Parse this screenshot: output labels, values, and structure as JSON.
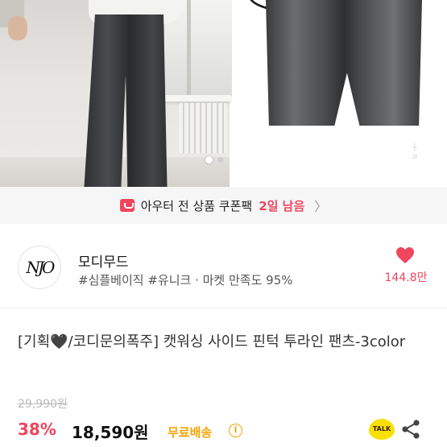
{
  "gallery": {
    "dots": 2,
    "active_dot": 1,
    "watermark": "|-/\n/-/̲"
  },
  "coupon_banner": {
    "text": "아우터 전 상품 쿠폰팩",
    "highlight": "2일 남음",
    "arrow": "〉",
    "accent_color": "#f0455d"
  },
  "shop": {
    "logo_text": "NJO",
    "name": "모디무드",
    "tags": "#심플베이직 #유니크 · 마켓 만족도 95%",
    "likes": "144.8만",
    "heart_color": "#f0455d"
  },
  "product": {
    "title": "[기획🖤/코디문의폭주] 캣워싱 사이드 핀턱 투라인 팬츠-3color",
    "original_price": "29,990원",
    "discount": "38%",
    "price": "18,590원",
    "shipping": "무료배송",
    "info_icon": "i",
    "talk_label": "TALK",
    "shipping_color": "#f5a300"
  }
}
